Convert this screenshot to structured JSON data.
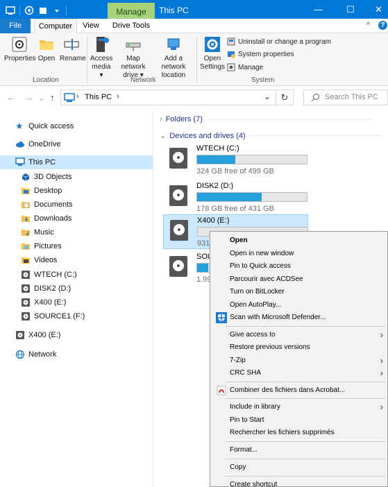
{
  "window": {
    "title": "This PC",
    "manage_tab": "Manage",
    "minimize": "—",
    "maximize": "☐",
    "close": "✕"
  },
  "menu_tabs": {
    "file": "File",
    "computer": "Computer",
    "view": "View",
    "drive_tools": "Drive Tools",
    "collapse": "^",
    "help": "?"
  },
  "ribbon": {
    "location": {
      "label": "Location",
      "properties": "Properties",
      "open": "Open",
      "rename": "Rename"
    },
    "network": {
      "label": "Network",
      "access_media_1": "Access",
      "access_media_2": "media ▾",
      "map_drive_1": "Map network",
      "map_drive_2": "drive ▾",
      "add_location_1": "Add a network",
      "add_location_2": "location"
    },
    "system": {
      "label": "System",
      "open_settings_1": "Open",
      "open_settings_2": "Settings",
      "uninstall": "Uninstall or change a program",
      "system_properties": "System properties",
      "manage": "Manage"
    }
  },
  "address": {
    "back": "←",
    "forward": "→",
    "up": "↑",
    "sep": "›",
    "crumb": "This PC",
    "dropdown": "⌄",
    "refresh": "↻",
    "search_placeholder": "Search This PC"
  },
  "nav": {
    "quick_access": "Quick access",
    "onedrive": "OneDrive",
    "this_pc": "This PC",
    "children": [
      "3D Objects",
      "Desktop",
      "Documents",
      "Downloads",
      "Music",
      "Pictures",
      "Videos",
      "WTECH (C:)",
      "DISK2 (D:)",
      "X400 (E:)",
      "SOURCE1 (F:)"
    ],
    "x400": "X400 (E:)",
    "network": "Network"
  },
  "content": {
    "folders_header": "Folders (7)",
    "drives_header": "Devices and drives (4)",
    "drives": [
      {
        "name": "WTECH (C:)",
        "free": "324 GB free of 499 GB",
        "used_fraction": 0.35
      },
      {
        "name": "DISK2 (D:)",
        "free": "178 GB free of 431 GB",
        "used_fraction": 0.59
      },
      {
        "name": "X400 (E:)",
        "free": "931",
        "used_fraction": 0.0
      },
      {
        "name": "SOU",
        "free": "1.99",
        "used_fraction": 0.1
      }
    ]
  },
  "context_menu": {
    "items": [
      "Open",
      "Open in new window",
      "Pin to Quick access",
      "Parcourir avec ACDSee",
      "Turn on BitLocker",
      "Open AutoPlay...",
      "Scan with Microsoft Defender...",
      "Give access to",
      "Restore previous versions",
      "7-Zip",
      "CRC SHA",
      "Combiner des fichiers dans Acrobat...",
      "Include in library",
      "Pin to Start",
      "Rechercher les fichiers supprimés",
      "Format...",
      "Copy",
      "Create shortcut"
    ],
    "submenu_arrow": "›"
  },
  "colors": {
    "accent": "#0078d7",
    "manage_tab": "#a8d27a",
    "selection": "#cce8ff",
    "drive_bar": "#26a0da"
  }
}
